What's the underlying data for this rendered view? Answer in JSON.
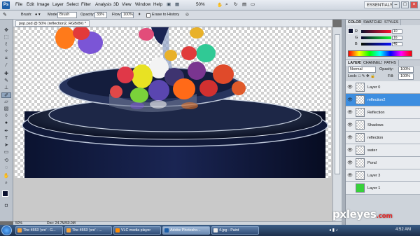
{
  "app": {
    "logo": "Ps",
    "workspace": "ESSENTIALS",
    "zoom": "50%"
  },
  "menu": [
    "File",
    "Edit",
    "Image",
    "Layer",
    "Select",
    "Filter",
    "Analysis",
    "3D",
    "View",
    "Window",
    "Help"
  ],
  "options_bar": {
    "brush_label": "Brush:",
    "mode_label": "Mode:",
    "mode_value": "Brush",
    "opacity_label": "Opacity:",
    "opacity_value": "33%",
    "flow_label": "Flow:",
    "flow_value": "100%",
    "erase_label": "Erase to History"
  },
  "document": {
    "tab_title": "pop.psd @ 50% (reflection2, RGB/8#) *"
  },
  "status": {
    "zoom": "50%",
    "doc": "Doc: 24.7M/60.0M"
  },
  "panels": {
    "color_tabs": [
      "COLOR",
      "SWATCHES",
      "STYLES"
    ],
    "color_values": {
      "r": "10",
      "g": "16",
      "b": "46"
    },
    "color_labels": [
      "R",
      "G",
      "B"
    ],
    "layers_tabs": [
      "LAYERS",
      "CHANNELS",
      "PATHS"
    ],
    "blend_mode": "Normal",
    "opacity_label": "Opacity:",
    "opacity_value": "100%",
    "lock_label": "Lock:",
    "fill_label": "Fill:",
    "fill_value": "100%",
    "layers": [
      {
        "name": "Layer 0"
      },
      {
        "name": "reflection2"
      },
      {
        "name": "Reflection"
      },
      {
        "name": "Shadows"
      },
      {
        "name": "reflection"
      },
      {
        "name": "water"
      },
      {
        "name": "Pond"
      },
      {
        "name": "Layer 3"
      },
      {
        "name": "Layer 1"
      }
    ]
  },
  "taskbar": [
    {
      "label": "The 4553 'pro' - G..."
    },
    {
      "label": "The 4553 'pro' - ..."
    },
    {
      "label": "VLC media player"
    },
    {
      "label": "Adobe Photosho..."
    },
    {
      "label": "4.jpg - Paint"
    }
  ],
  "clock": "4:52 AM",
  "watermark": {
    "text": "pxleyes",
    "suffix": ".com"
  },
  "colors": {
    "accent": "#3d8ee0",
    "layer1_green": "#37d13a",
    "fg_swatch": "#0a102e"
  }
}
